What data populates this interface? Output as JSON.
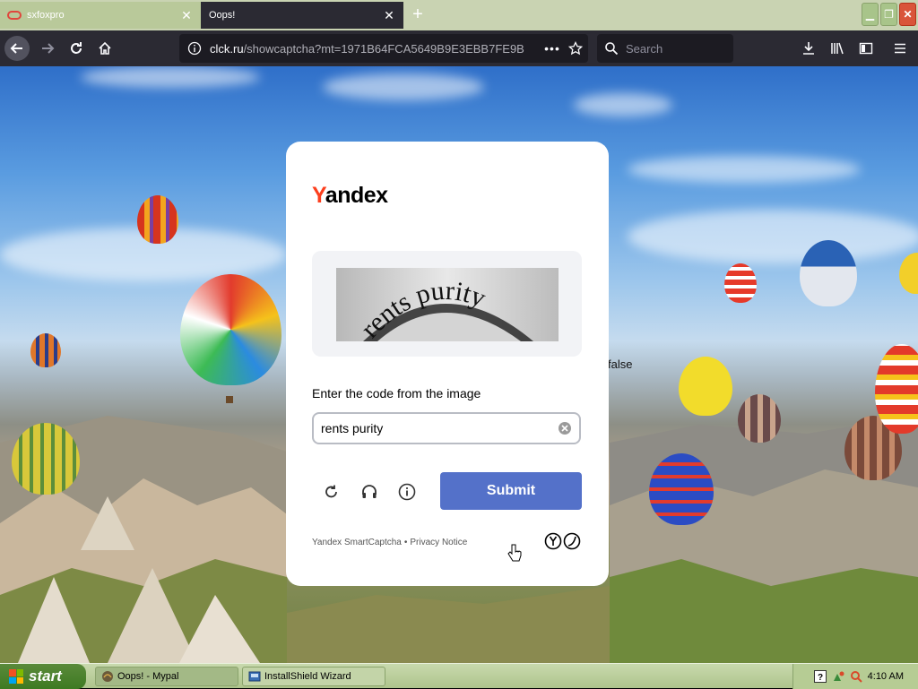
{
  "browser": {
    "tabs": [
      {
        "title": "sxfoxpro",
        "active": false
      },
      {
        "title": "Oops!",
        "active": true
      }
    ],
    "url_domain": "clck.ru",
    "url_path": "/showcaptcha?mt=1971B64FCA5649B9E3EBB7FE9B",
    "search_placeholder": "Search"
  },
  "page": {
    "stray_text": "false"
  },
  "captcha": {
    "logo_first": "Y",
    "logo_rest": "andex",
    "image_text": "rents purity",
    "prompt": "Enter the code from the image",
    "input_value": "rents purity",
    "submit_label": "Submit",
    "footer_brand": "Yandex SmartCaptcha",
    "footer_separator": "•",
    "footer_link": "Privacy Notice"
  },
  "taskbar": {
    "start_label": "start",
    "items": [
      {
        "label": "Oops! - Mypal",
        "active": true
      },
      {
        "label": "InstallShield Wizard",
        "active": false
      }
    ],
    "clock": "4:10 AM"
  },
  "colors": {
    "yandex_red": "#fc3f1d",
    "submit_blue": "#5471c9",
    "browser_chrome": "#2b2a33",
    "xp_green": "#3d7a22"
  }
}
